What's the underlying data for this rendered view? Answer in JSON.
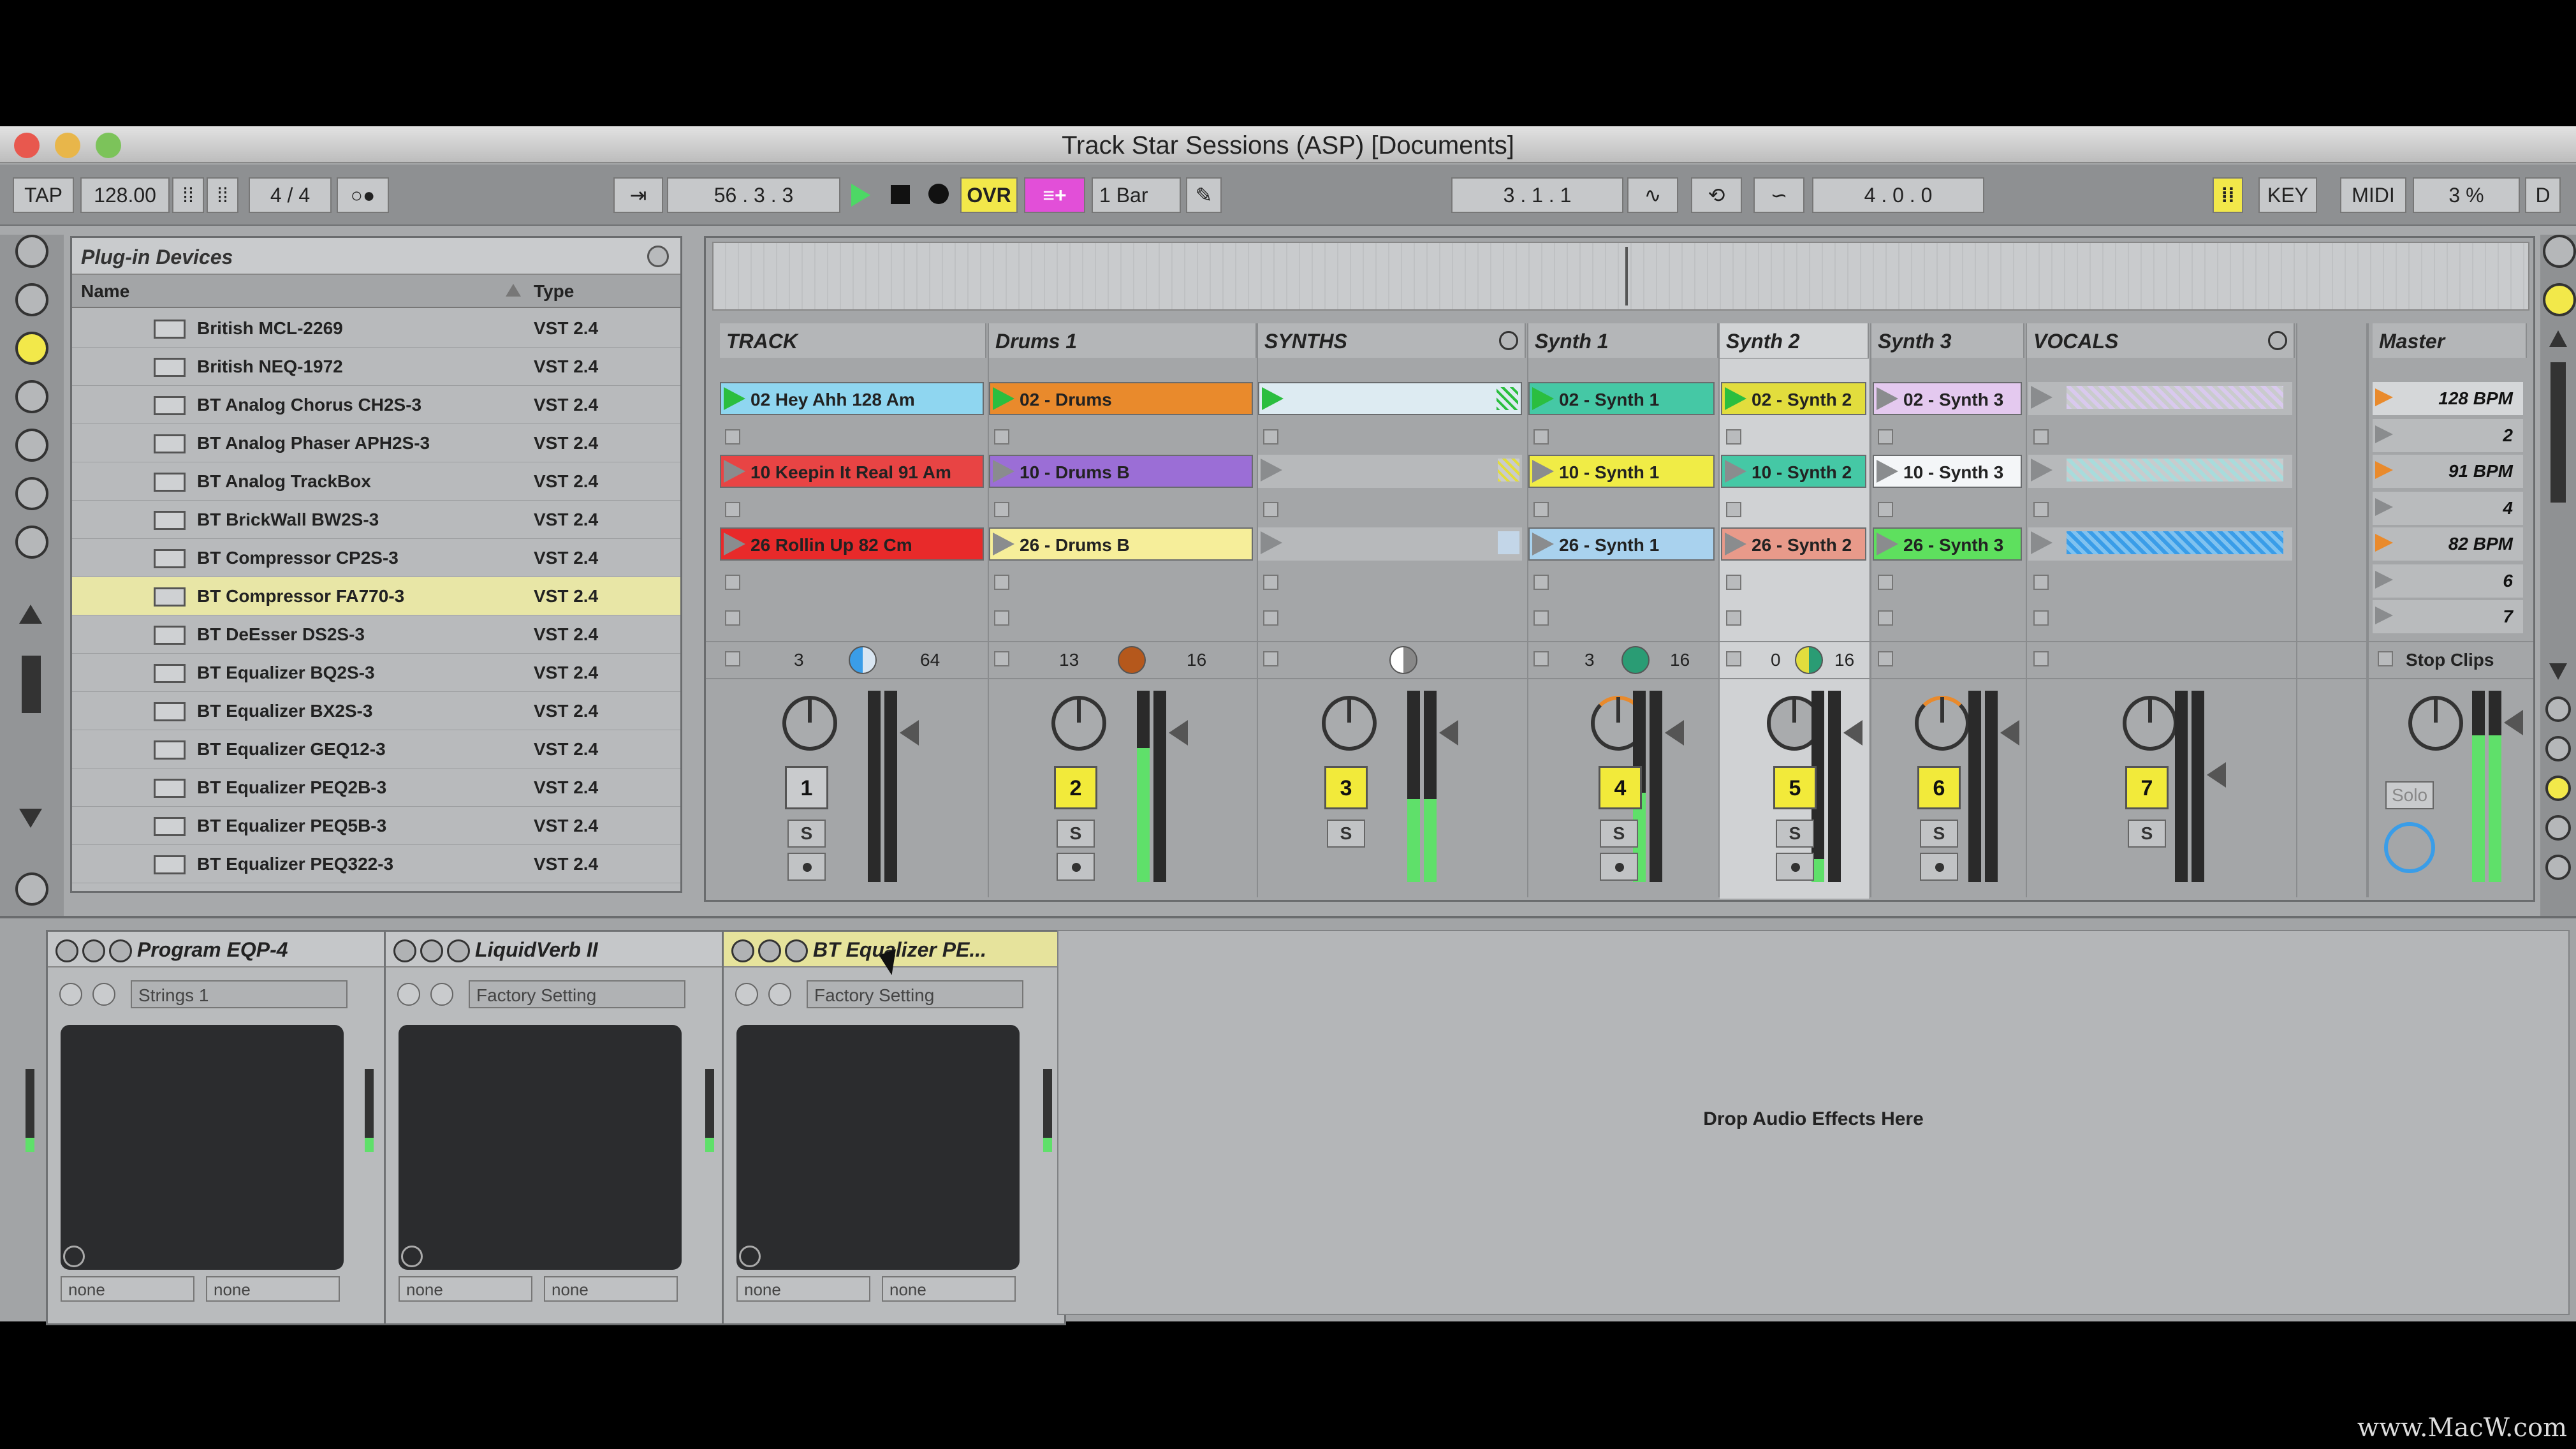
{
  "window": {
    "title": "Track Star Sessions (ASP)  [Documents]"
  },
  "control_bar": {
    "tap": "TAP",
    "tempo": "128.00",
    "time_signature": "4 / 4",
    "arrangement_position": "56 .  3 .  3",
    "ovr": "OVR",
    "quantization": "1 Bar",
    "loop_start": "3 .  1 .  1",
    "loop_length": "4 .  0 .  0",
    "key": "KEY",
    "midi": "MIDI",
    "cpu": "3 %",
    "d": "D"
  },
  "browser": {
    "title": "Plug-in Devices",
    "col_name": "Name",
    "col_type": "Type",
    "rows": [
      {
        "name": "British MCL-2269",
        "type": "VST 2.4"
      },
      {
        "name": "British NEQ-1972",
        "type": "VST 2.4"
      },
      {
        "name": "BT Analog Chorus CH2S-3",
        "type": "VST 2.4"
      },
      {
        "name": "BT Analog Phaser APH2S-3",
        "type": "VST 2.4"
      },
      {
        "name": "BT Analog TrackBox",
        "type": "VST 2.4"
      },
      {
        "name": "BT BrickWall BW2S-3",
        "type": "VST 2.4"
      },
      {
        "name": "BT Compressor CP2S-3",
        "type": "VST 2.4"
      },
      {
        "name": "BT Compressor FA770-3",
        "type": "VST 2.4"
      },
      {
        "name": "BT DeEsser DS2S-3",
        "type": "VST 2.4"
      },
      {
        "name": "BT Equalizer BQ2S-3",
        "type": "VST 2.4"
      },
      {
        "name": "BT Equalizer BX2S-3",
        "type": "VST 2.4"
      },
      {
        "name": "BT Equalizer GEQ12-3",
        "type": "VST 2.4"
      },
      {
        "name": "BT Equalizer PEQ2B-3",
        "type": "VST 2.4"
      },
      {
        "name": "BT Equalizer PEQ5B-3",
        "type": "VST 2.4"
      },
      {
        "name": "BT Equalizer PEQ322-3",
        "type": "VST 2.4"
      }
    ]
  },
  "tracks": {
    "t1": {
      "name": "TRACK",
      "clip1": "02  Hey Ahh 128 Am",
      "clip2": "10  Keepin It Real 91 Am",
      "clip3": "26  Rollin Up 82 Cm",
      "in": "3",
      "out": "64",
      "num": "1",
      "solo": "S"
    },
    "t2": {
      "name": "Drums   1",
      "clip1": "02 - Drums",
      "clip2": "10 - Drums B",
      "clip3": "26 - Drums B",
      "in": "13",
      "out": "16",
      "num": "2",
      "solo": "S"
    },
    "t3": {
      "name": "SYNTHS",
      "num": "3",
      "solo": "S"
    },
    "t4": {
      "name": "Synth 1",
      "clip1": "02 - Synth 1",
      "clip2": "10 - Synth 1",
      "clip3": "26 - Synth 1",
      "in": "3",
      "out": "16",
      "num": "4",
      "solo": "S"
    },
    "t5": {
      "name": "Synth 2",
      "clip1": "02 - Synth 2",
      "clip2": "10 - Synth 2",
      "clip3": "26 - Synth 2",
      "in": "0",
      "out": "16",
      "num": "5",
      "solo": "S"
    },
    "t6": {
      "name": "Synth 3",
      "clip1": "02 - Synth 3",
      "clip2": "10 - Synth 3",
      "clip3": "26 - Synth 3",
      "num": "6",
      "solo": "S"
    },
    "t7": {
      "name": "VOCALS",
      "num": "7",
      "solo": "S"
    },
    "master": {
      "name": "Master",
      "scenes": [
        "128 BPM",
        "2",
        "91 BPM",
        "4",
        "82 BPM",
        "6",
        "7"
      ],
      "stop_clips": "Stop Clips",
      "solo": "Solo"
    }
  },
  "devices": [
    {
      "name": "Program EQP-4",
      "preset": "Strings 1",
      "sel1": "none",
      "sel2": "none"
    },
    {
      "name": "LiquidVerb II",
      "preset": "Factory Setting",
      "sel1": "none",
      "sel2": "none"
    },
    {
      "name": "BT Equalizer PE...",
      "preset": "Factory Setting",
      "sel1": "none",
      "sel2": "none"
    }
  ],
  "drop_hint": "Drop Audio Effects Here",
  "watermark": "www.MacW.com"
}
